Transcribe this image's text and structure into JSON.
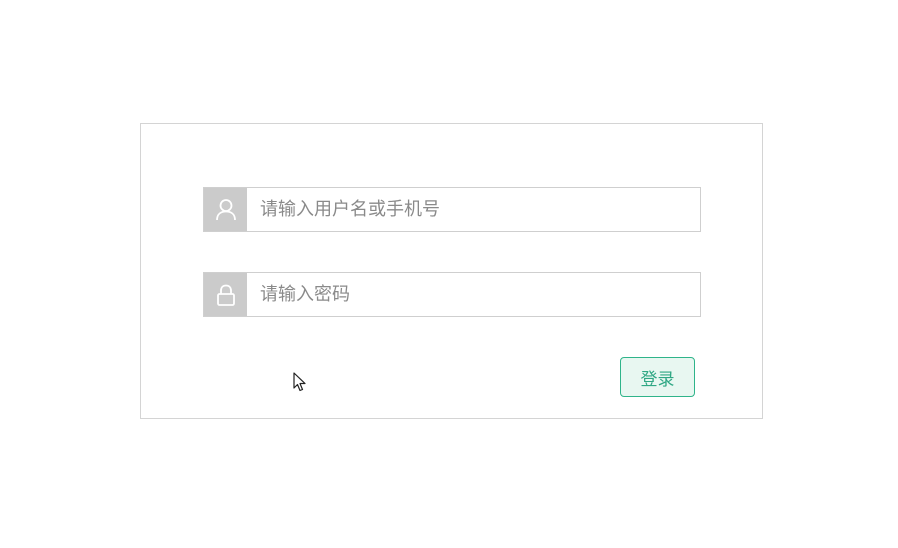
{
  "login_form": {
    "username": {
      "icon": "user-icon",
      "placeholder": "请输入用户名或手机号",
      "value": ""
    },
    "password": {
      "icon": "lock-icon",
      "placeholder": "请输入密码",
      "value": ""
    },
    "submit_label": "登录"
  },
  "colors": {
    "accent": "#2fa784",
    "button_bg": "#e8f7f1",
    "icon_bg": "#cbcbcb",
    "border": "#cfcfcf"
  }
}
